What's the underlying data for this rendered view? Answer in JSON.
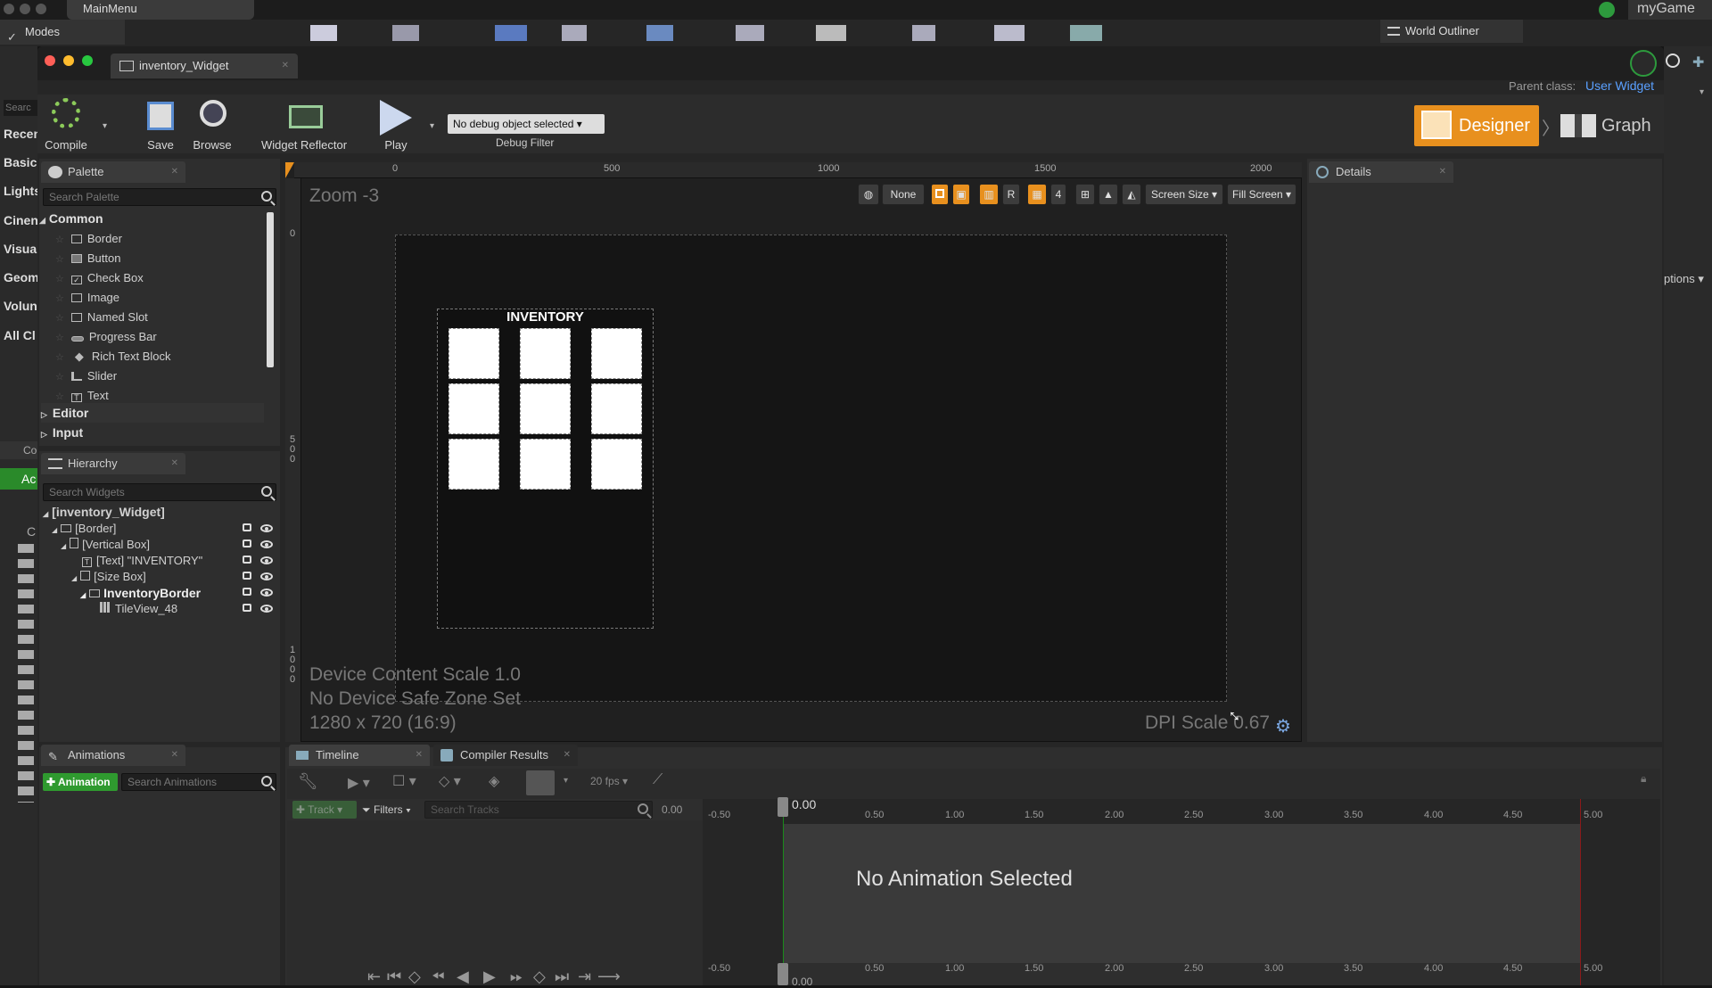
{
  "main_window": {
    "tab": "MainMenu",
    "project": "myGame",
    "modes_label": "Modes",
    "world_outliner_tab": "World Outliner",
    "left_categories": [
      "Searc",
      "Recen",
      "Basic",
      "Lights",
      "Cinen",
      "Visua",
      "Geom",
      "Volun",
      "All Cl"
    ],
    "content_labels": [
      "Co",
      "Ac",
      "C"
    ],
    "options_label": "ptions"
  },
  "editor": {
    "tab_title": "inventory_Widget",
    "parent_class_label": "Parent class:",
    "parent_class_value": "User Widget"
  },
  "toolbar": {
    "compile": "Compile",
    "save": "Save",
    "browse": "Browse",
    "widget_reflector": "Widget Reflector",
    "play": "Play",
    "debug_select": "No debug object selected",
    "debug_filter": "Debug Filter",
    "designer": "Designer",
    "graph": "Graph"
  },
  "palette": {
    "tab": "Palette",
    "search_placeholder": "Search Palette",
    "category_common": "Common",
    "items": [
      "Border",
      "Button",
      "Check Box",
      "Image",
      "Named Slot",
      "Progress Bar",
      "Rich Text Block",
      "Slider",
      "Text"
    ],
    "category_editor": "Editor",
    "category_input": "Input"
  },
  "hierarchy": {
    "tab": "Hierarchy",
    "search_placeholder": "Search Widgets",
    "root": "[inventory_Widget]",
    "nodes": [
      "[Border]",
      "[Vertical Box]",
      "[Text] \"INVENTORY\"",
      "[Size Box]",
      "InventoryBorder",
      "TileView_48"
    ]
  },
  "designer": {
    "zoom": "Zoom -3",
    "ruler_top": [
      "0",
      "500",
      "1000",
      "1500",
      "2000"
    ],
    "ruler_left": [
      "0",
      "500",
      "1000"
    ],
    "none_button": "None",
    "r_button": "R",
    "grid_value": "4",
    "screen_size": "Screen Size",
    "fill_screen": "Fill Screen",
    "widget_title": "INVENTORY",
    "inventory_slot_count": 9,
    "device_content_scale": "Device Content Scale 1.0",
    "safe_zone": "No Device Safe Zone Set",
    "resolution": "1280 x 720 (16:9)",
    "dpi_scale": "DPI Scale 0.67"
  },
  "details": {
    "tab": "Details"
  },
  "animations": {
    "tab": "Animations",
    "add_button": "Animation",
    "search_placeholder": "Search Animations"
  },
  "timeline": {
    "tab": "Timeline",
    "compiler_tab": "Compiler Results",
    "fps": "20 fps",
    "track_button": "Track",
    "filters_button": "Filters",
    "search_placeholder": "Search Tracks",
    "time_value": "0.00",
    "playhead": "0.00",
    "ticks": [
      "-0.50",
      "0.50",
      "1.00",
      "1.50",
      "2.00",
      "2.50",
      "3.00",
      "3.50",
      "4.00",
      "4.50",
      "5.00"
    ],
    "empty_message": "No Animation Selected"
  },
  "colors": {
    "accent_orange": "#e8901e",
    "link_blue": "#5aa0ff",
    "add_green": "#2f9a2f"
  }
}
